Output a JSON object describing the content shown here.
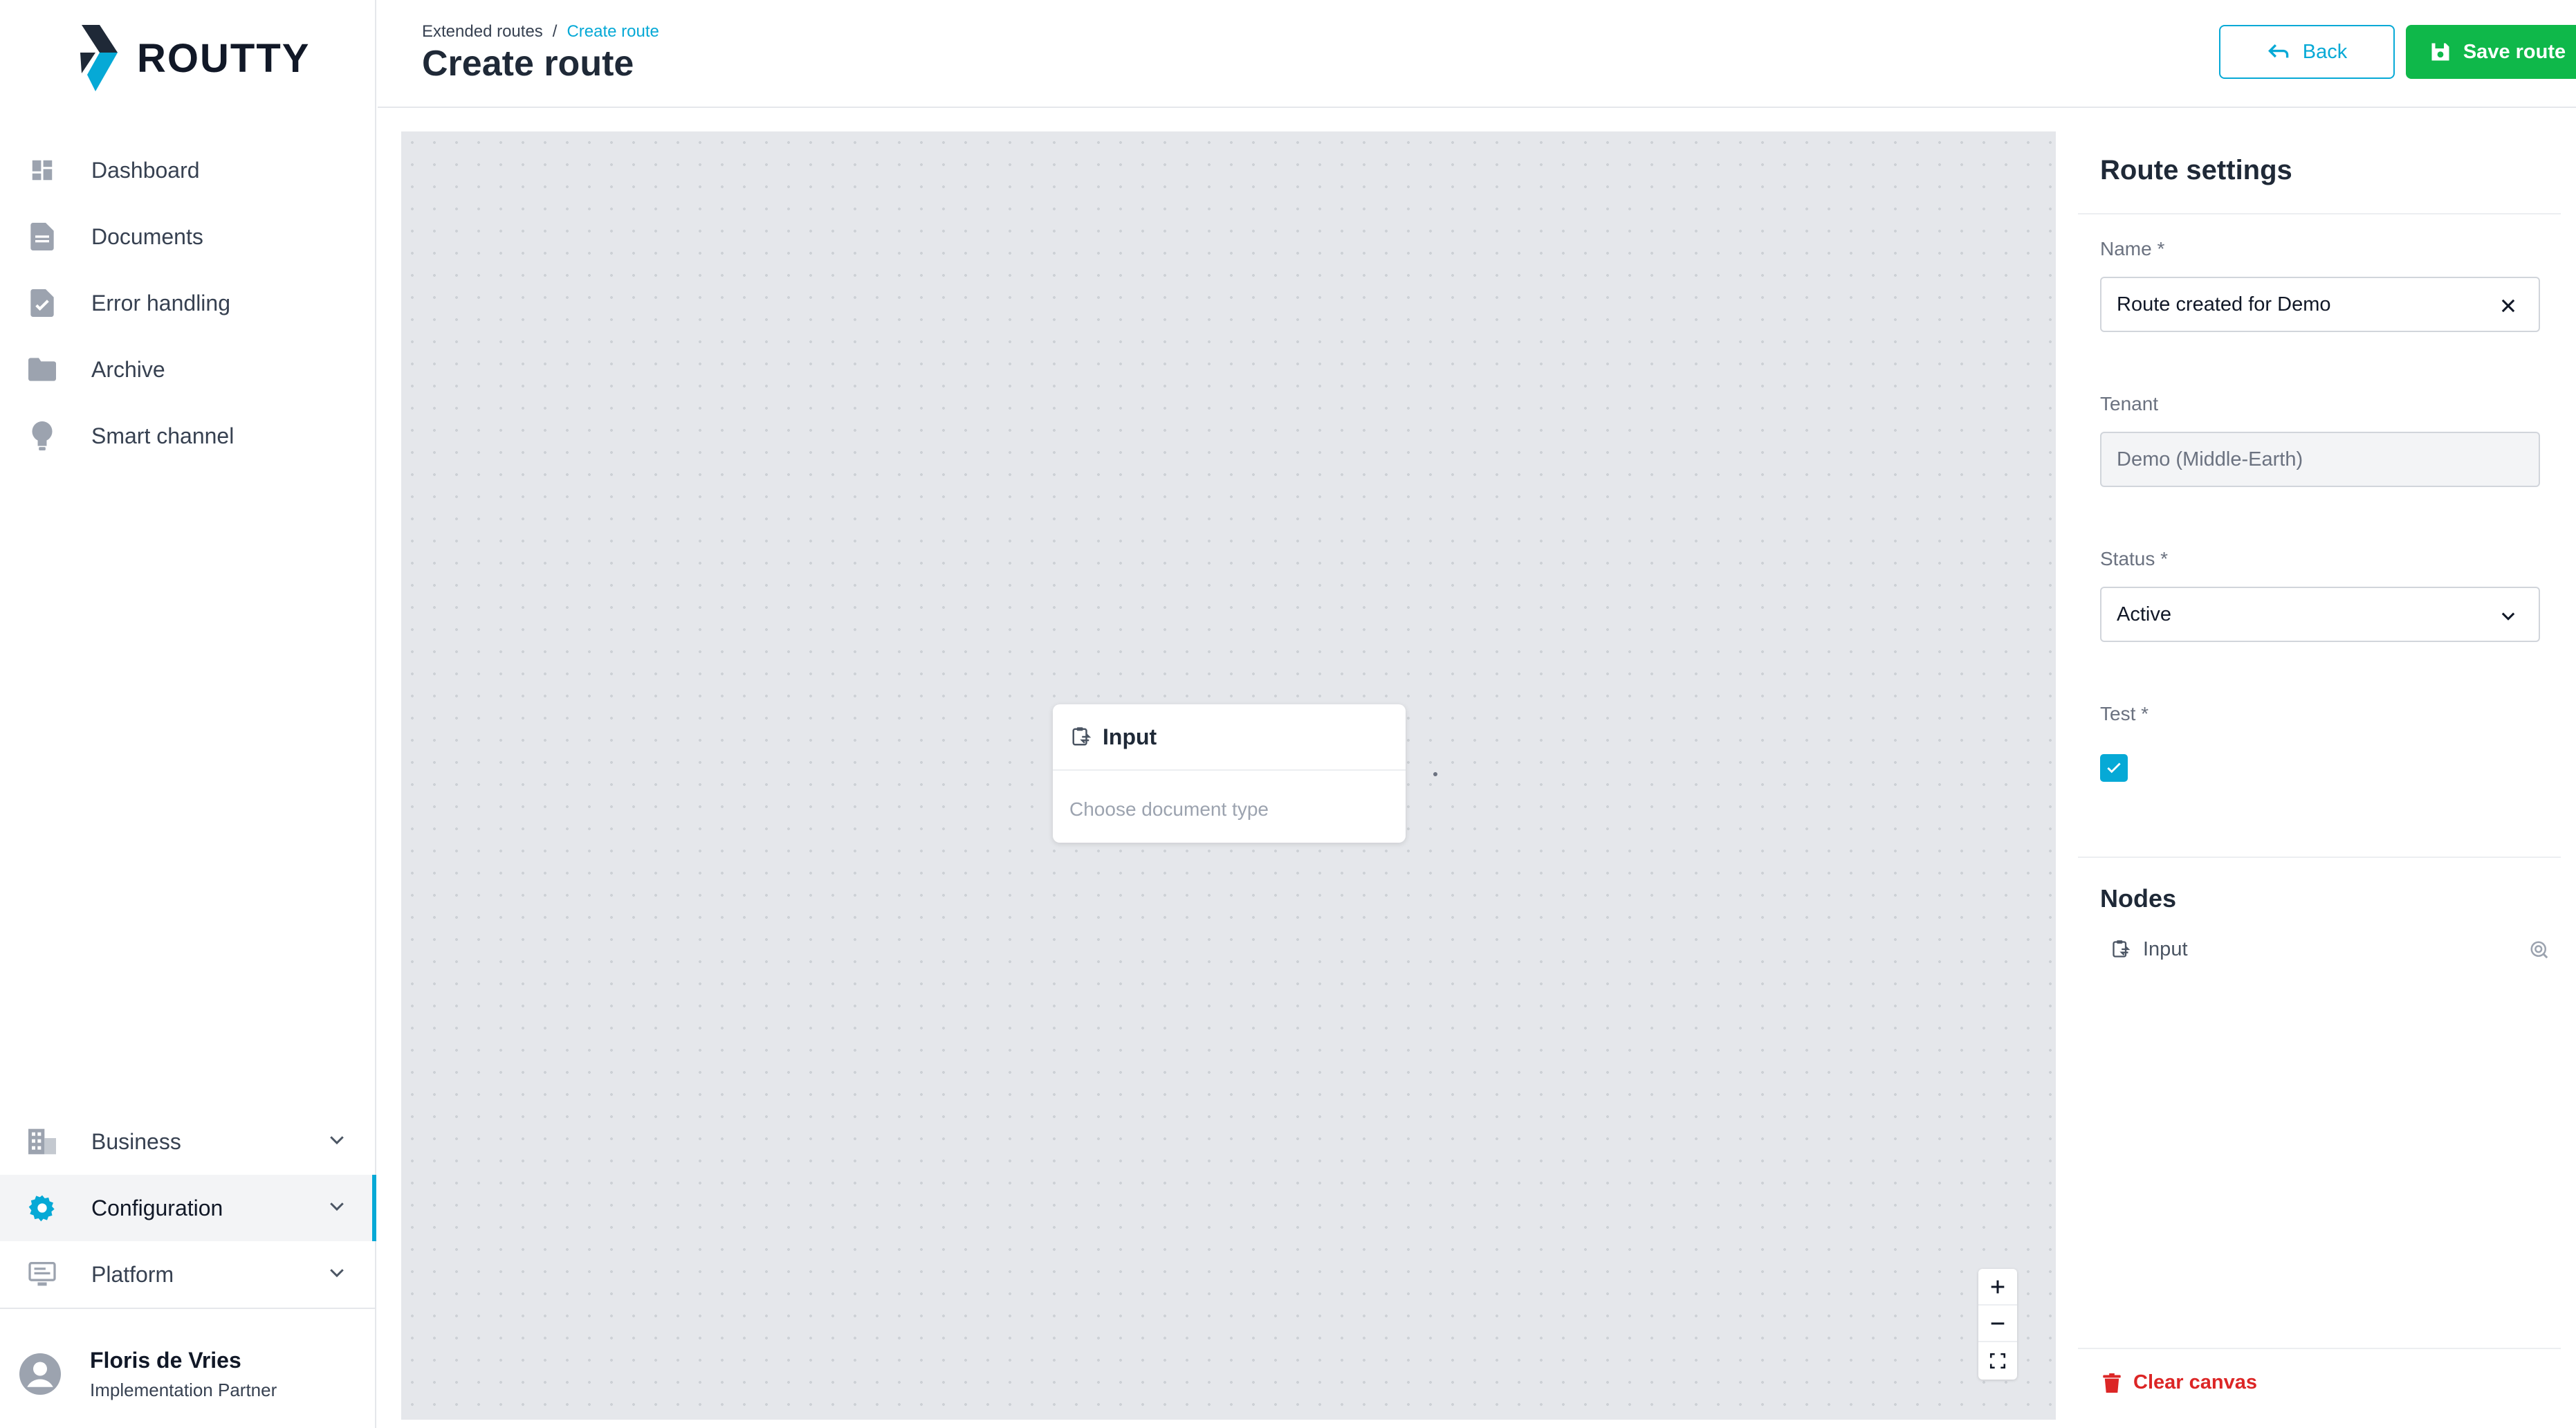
{
  "app": {
    "logo_text": "ROUTTY"
  },
  "sidebar": {
    "items": [
      {
        "label": "Dashboard",
        "icon": "dashboard-icon"
      },
      {
        "label": "Documents",
        "icon": "document-icon"
      },
      {
        "label": "Error handling",
        "icon": "document-check-icon"
      },
      {
        "label": "Archive",
        "icon": "folder-icon"
      },
      {
        "label": "Smart channel",
        "icon": "lightbulb-icon"
      }
    ],
    "groups": [
      {
        "label": "Business",
        "icon": "building-icon",
        "expanded": false
      },
      {
        "label": "Configuration",
        "icon": "gear-icon",
        "expanded": false,
        "active": true
      },
      {
        "label": "Platform",
        "icon": "monitor-icon",
        "expanded": false
      }
    ],
    "user": {
      "name": "Floris de Vries",
      "role": "Implementation Partner"
    }
  },
  "header": {
    "breadcrumb": [
      "Extended routes",
      "Create route"
    ],
    "breadcrumb_separator": "/",
    "title": "Create route",
    "back_label": "Back",
    "save_label": "Save route"
  },
  "canvas": {
    "node": {
      "title": "Input",
      "placeholder": "Choose document type",
      "icon": "clipboard-swap-icon"
    },
    "zoom_controls": [
      "zoom-in-icon",
      "zoom-out-icon",
      "fit-view-icon"
    ]
  },
  "panel": {
    "title": "Route settings",
    "name": {
      "label": "Name *",
      "value": "Route created for Demo"
    },
    "tenant": {
      "label": "Tenant",
      "value": "Demo (Middle-Earth)"
    },
    "status": {
      "label": "Status *",
      "value": "Active"
    },
    "test": {
      "label": "Test *",
      "checked": true
    },
    "nodes_title": "Nodes",
    "nodes": [
      {
        "label": "Input"
      }
    ],
    "clear_label": "Clear canvas"
  },
  "colors": {
    "accent": "#06a9d6",
    "save": "#0fb84a",
    "danger": "#dc2626",
    "canvas_bg": "#e5e7eb"
  }
}
